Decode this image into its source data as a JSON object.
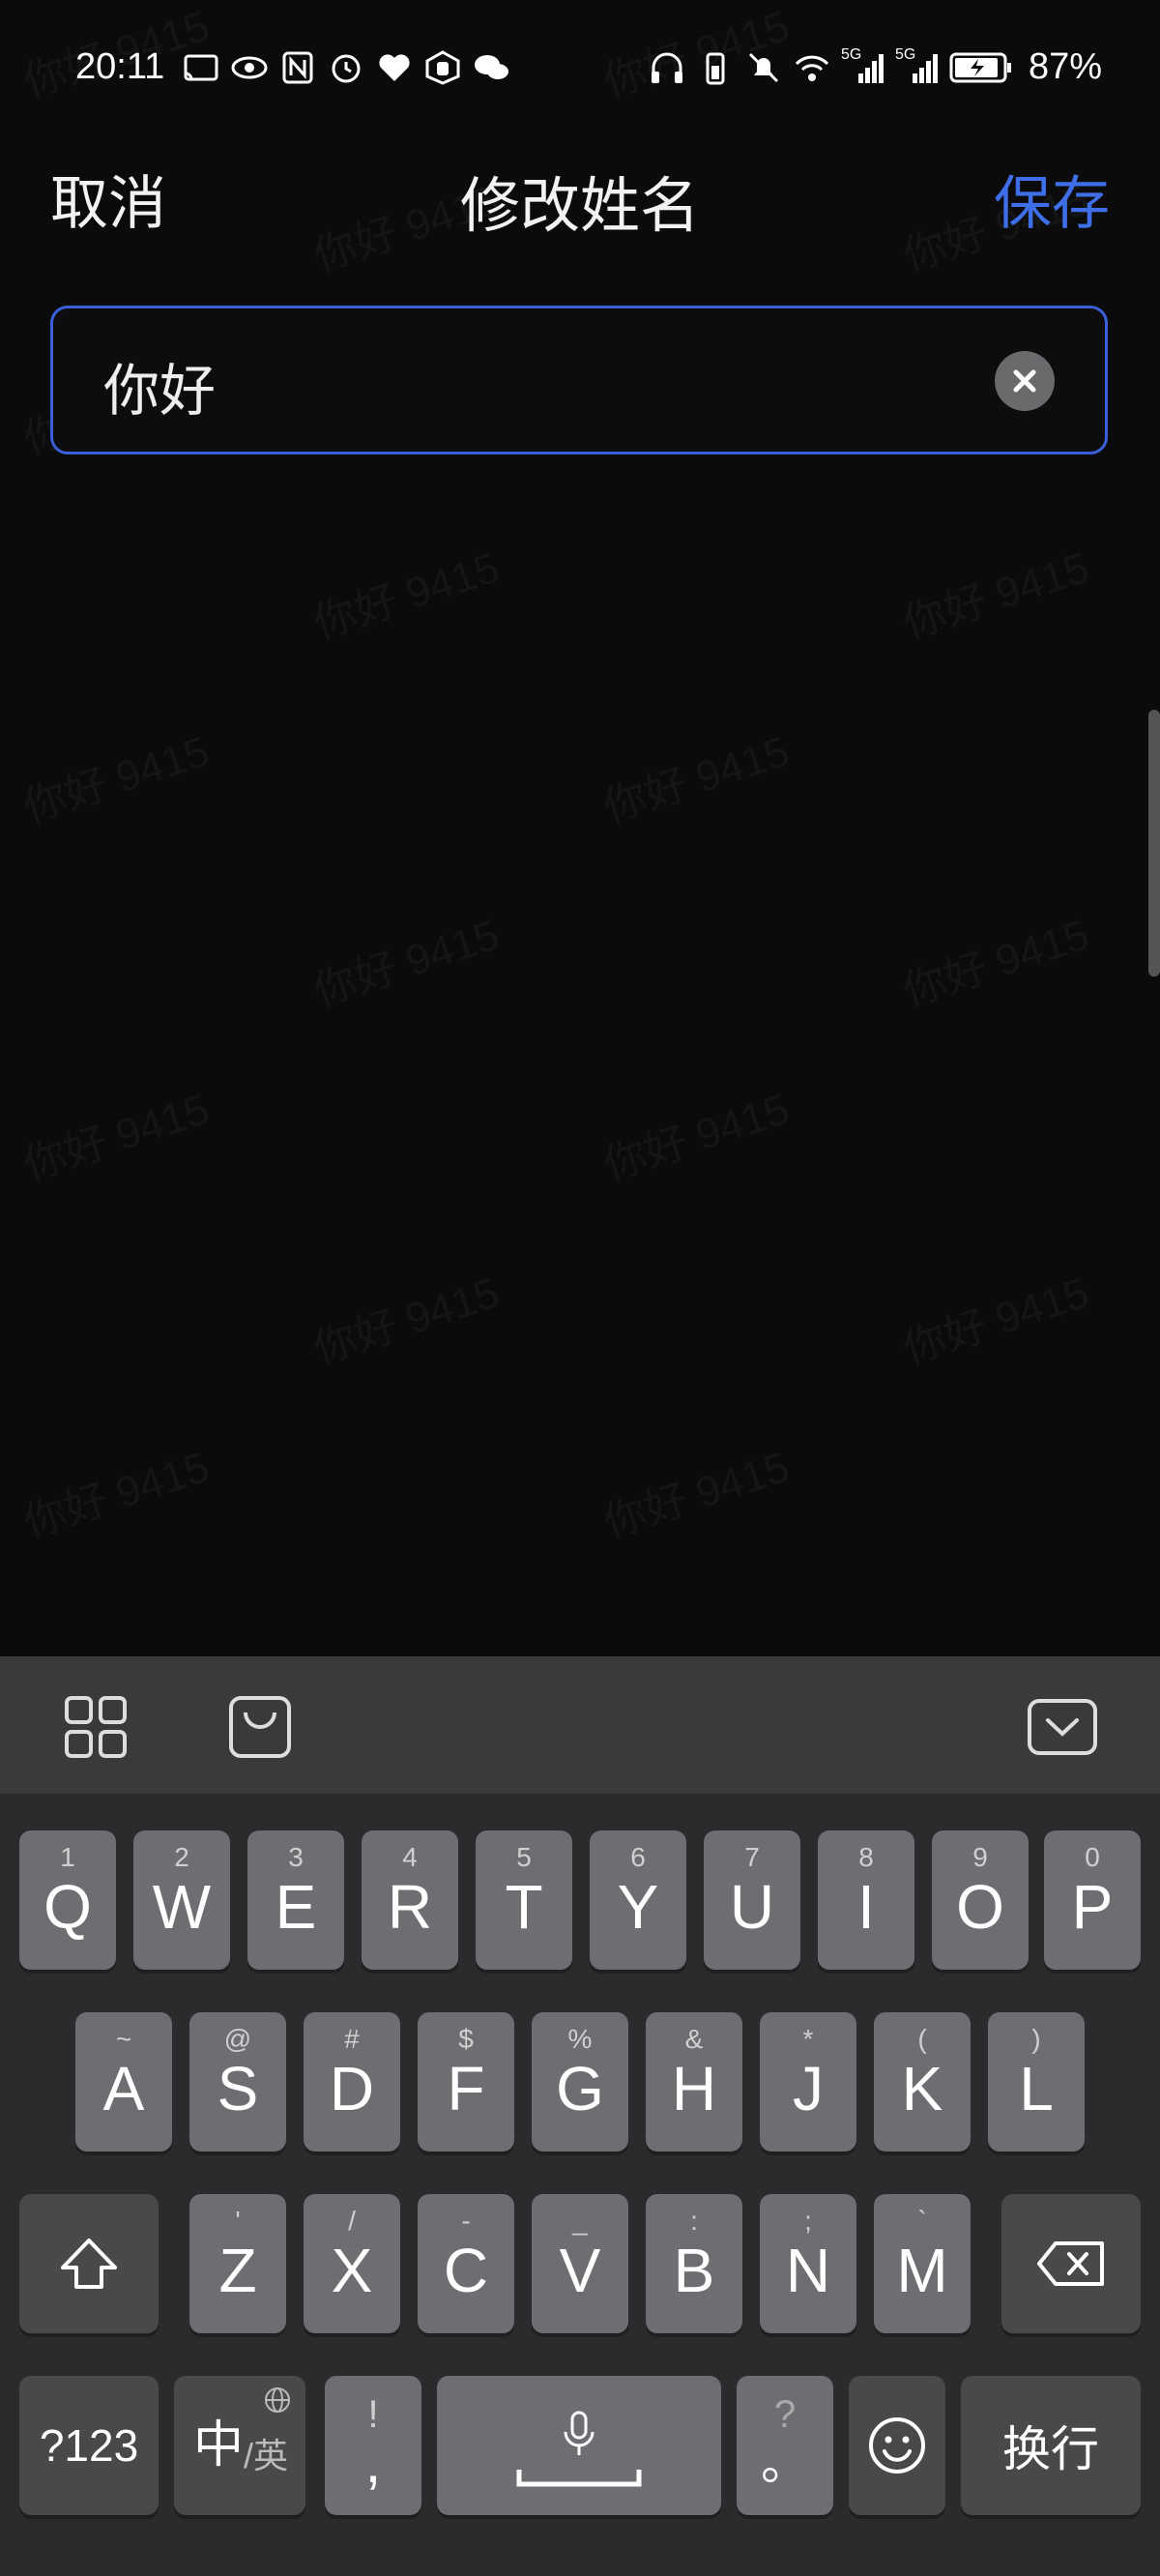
{
  "status": {
    "time": "20:11",
    "battery_percent": "87%",
    "network_labels": [
      "5G",
      "5G"
    ],
    "left_icons": [
      "cast-icon",
      "eye-icon",
      "nfc-icon",
      "alarm-icon",
      "health-icon",
      "hand-icon",
      "wechat-icon"
    ],
    "right_icons": [
      "headphones-icon",
      "battery-saver-icon",
      "mute-icon",
      "wifi-icon",
      "signal-icon",
      "signal-icon",
      "battery-icon"
    ]
  },
  "header": {
    "cancel_label": "取消",
    "title": "修改姓名",
    "save_label": "保存"
  },
  "name_input": {
    "value": "你好"
  },
  "watermark_text": "你好 9415",
  "keyboard": {
    "toolbar_icons": [
      "grid-icon",
      "bag-icon",
      "collapse-keyboard-icon"
    ],
    "row1": [
      {
        "main": "Q",
        "sub": "1"
      },
      {
        "main": "W",
        "sub": "2"
      },
      {
        "main": "E",
        "sub": "3"
      },
      {
        "main": "R",
        "sub": "4"
      },
      {
        "main": "T",
        "sub": "5"
      },
      {
        "main": "Y",
        "sub": "6"
      },
      {
        "main": "U",
        "sub": "7"
      },
      {
        "main": "I",
        "sub": "8"
      },
      {
        "main": "O",
        "sub": "9"
      },
      {
        "main": "P",
        "sub": "0"
      }
    ],
    "row2": [
      {
        "main": "A",
        "sub": "~"
      },
      {
        "main": "S",
        "sub": "@"
      },
      {
        "main": "D",
        "sub": "#"
      },
      {
        "main": "F",
        "sub": "$"
      },
      {
        "main": "G",
        "sub": "%"
      },
      {
        "main": "H",
        "sub": "&"
      },
      {
        "main": "J",
        "sub": "*"
      },
      {
        "main": "K",
        "sub": "("
      },
      {
        "main": "L",
        "sub": ")"
      }
    ],
    "row3": [
      {
        "main": "Z",
        "sub": "'"
      },
      {
        "main": "X",
        "sub": "/"
      },
      {
        "main": "C",
        "sub": "-"
      },
      {
        "main": "V",
        "sub": "_"
      },
      {
        "main": "B",
        "sub": ":"
      },
      {
        "main": "N",
        "sub": ";"
      },
      {
        "main": "M",
        "sub": "`"
      }
    ],
    "numbers_label": "?123",
    "lang_main": "中",
    "lang_sub": "/英",
    "comma_main": ",",
    "comma_sub": "!",
    "period_main": "。",
    "period_sub": "?",
    "enter_label": "换行"
  }
}
